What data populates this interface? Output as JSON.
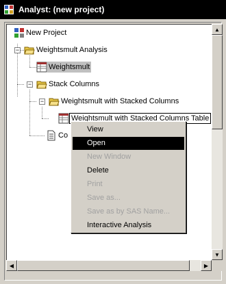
{
  "window": {
    "title": "Analyst: (new project)"
  },
  "tree": {
    "new_project": "New Project",
    "weightsmult_analysis": "Weightsmult Analysis",
    "weightsmult": "Weightsmult",
    "stack_columns": "Stack Columns",
    "weightsmult_stacked": "Weightsmult with Stacked Columns",
    "weightsmult_stacked_table": "Weightsmult with Stacked Columns Table",
    "code_partial": "Co"
  },
  "context_menu": {
    "items": [
      {
        "label": "View",
        "state": "normal"
      },
      {
        "label": "Open",
        "state": "highlighted"
      },
      {
        "label": "New Window",
        "state": "disabled"
      },
      {
        "label": "Delete",
        "state": "normal"
      },
      {
        "label": "Print",
        "state": "disabled"
      },
      {
        "label": "Save as...",
        "state": "disabled"
      },
      {
        "label": "Save as by SAS Name...",
        "state": "disabled"
      },
      {
        "label": "Interactive Analysis",
        "state": "normal"
      }
    ]
  },
  "colors": {
    "titlebar": "#000000",
    "folder": "#e8c84a",
    "highlight": "#000000"
  },
  "icons": [
    "analyst-app-icon",
    "project-icon",
    "folder-open-icon",
    "table-icon",
    "document-icon",
    "expand-minus-icon",
    "scroll-up-icon",
    "scroll-down-icon",
    "scroll-left-icon",
    "scroll-right-icon"
  ]
}
